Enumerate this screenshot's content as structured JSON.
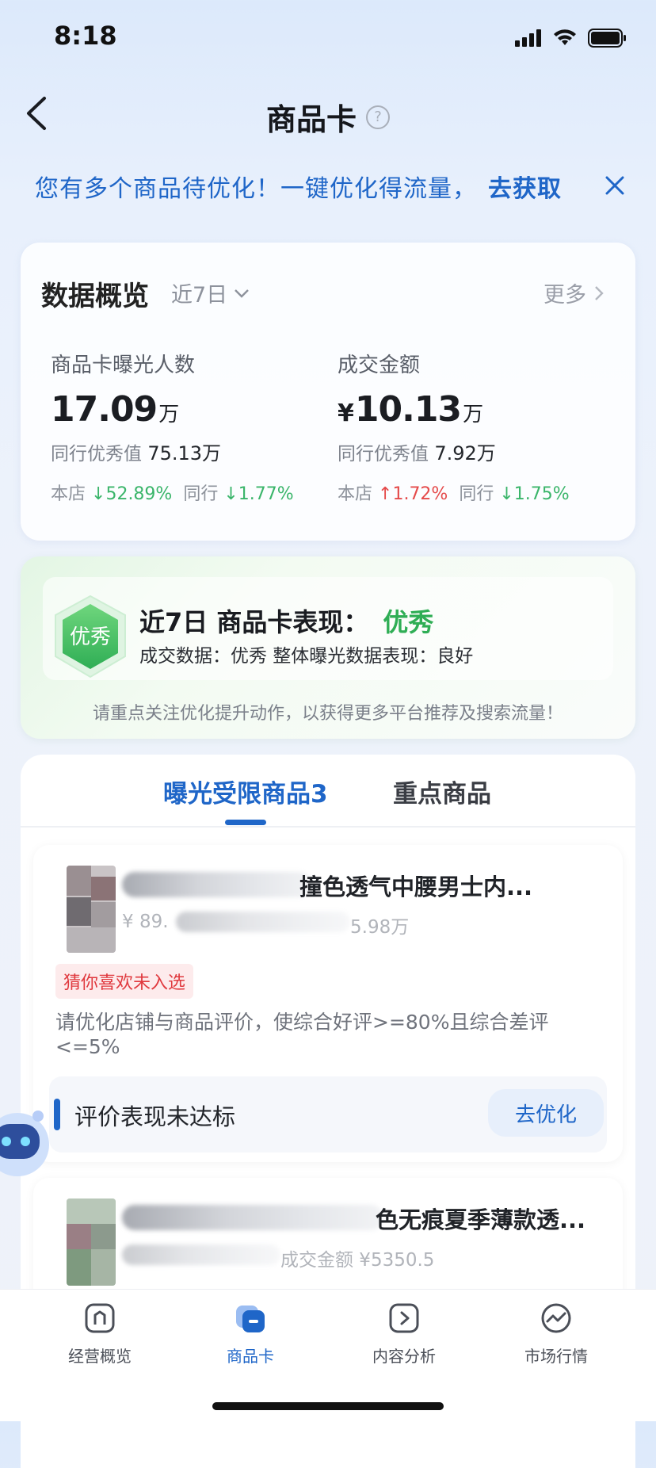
{
  "status_bar": {
    "time": "8:18"
  },
  "nav": {
    "title": "商品卡",
    "help_symbol": "?"
  },
  "banner": {
    "text": "您有多个商品待优化！一键优化得流量，",
    "link": "去获取"
  },
  "overview": {
    "title": "数据概览",
    "range": "近7日",
    "more": "更多",
    "metrics": [
      {
        "label": "商品卡曝光人数",
        "currency": "",
        "value": "17.09",
        "unit": "万",
        "peer_label": "同行优秀值",
        "peer_value": "75.13万",
        "store_label": "本店",
        "store_trend": "↓52.89%",
        "peer_trend_label": "同行",
        "peer_trend": "↓1.77%"
      },
      {
        "label": "成交金额",
        "currency": "¥",
        "value": "10.13",
        "unit": "万",
        "peer_label": "同行优秀值",
        "peer_value": "7.92万",
        "store_label": "本店",
        "store_trend": "↑1.72%",
        "peer_trend_label": "同行",
        "peer_trend": "↓1.75%"
      }
    ]
  },
  "performance": {
    "badge": "优秀",
    "title_prefix": "近7日 商品卡表现：",
    "rating": "优秀",
    "detail": "成交数据：优秀   整体曝光数据表现：良好",
    "note": "请重点关注优化提升动作，以获得更多平台推荐及搜索流量！"
  },
  "tabs": [
    {
      "label": "曝光受限商品3"
    },
    {
      "label": "重点商品"
    }
  ],
  "items": [
    {
      "name_visible": "撞色透气中腰男士内...",
      "meta_left": "¥ 89.",
      "meta_right": "5.98万",
      "tag": "猜你喜欢未入选",
      "hint": "请优化店铺与商品评价，使综合好评>=80%且综合差评<=5%",
      "status": "评价表现未达标",
      "action": "去优化"
    },
    {
      "name_visible": "色无痕夏季薄款透...",
      "meta": "成交金额 ¥5350.5"
    }
  ],
  "bottom_nav": [
    {
      "label": "经营概览",
      "icon": "home-icon"
    },
    {
      "label": "商品卡",
      "icon": "product-card-icon"
    },
    {
      "label": "内容分析",
      "icon": "content-play-icon"
    },
    {
      "label": "市场行情",
      "icon": "market-trend-icon"
    }
  ],
  "colors": {
    "accent": "#1f66c8",
    "trend_down": "#3ab56a",
    "trend_up": "#e54a4a",
    "good": "#2fae55",
    "tag_red": "#e0393e"
  }
}
